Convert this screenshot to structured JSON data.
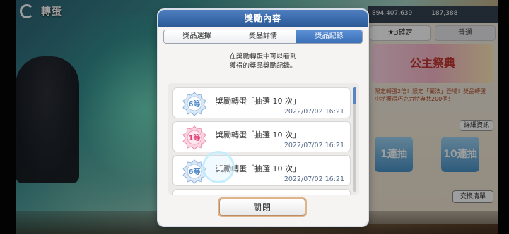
{
  "background": {
    "title": "轉蛋",
    "panel_tabs": [
      "★3確定",
      "普通"
    ],
    "banner_text": "公主祭典",
    "description": "限定轉蛋2倍！限定「蘭法」登場！獎品轉蛋中將獲得巧克力特典共200個！",
    "detail_button": "詳細資訊",
    "pull_buttons": [
      "1連抽",
      "10連抽"
    ],
    "exchange_button": "交換清單",
    "currency_1": "894,407,639",
    "currency_2": "187,388"
  },
  "modal": {
    "title": "獎勵內容",
    "tabs": [
      {
        "label": "獎品選擇",
        "active": false
      },
      {
        "label": "獎品詳情",
        "active": false
      },
      {
        "label": "獎品記錄",
        "active": true
      }
    ],
    "intro_line1": "在獎勵轉蛋中可以看到",
    "intro_line2": "獲得的獎品獎勵記錄。",
    "records": [
      {
        "medal": "6等",
        "medal_color": "#4a86c8",
        "name": "獎勵轉蛋「抽選 10 次」",
        "date": "2022/07/02 16:21"
      },
      {
        "medal": "1等",
        "medal_color": "#e0457a",
        "name": "獎勵轉蛋「抽選 10 次」",
        "date": "2022/07/02 16:21"
      },
      {
        "medal": "6等",
        "medal_color": "#4a86c8",
        "name": "獎勵轉蛋「抽選 10 次」",
        "date": "2022/07/02 16:21"
      }
    ],
    "close_label": "關閉"
  },
  "colors": {
    "header_blue": "#3868a8",
    "active_tab": "#4a7fc4",
    "date_text": "#5a6d8a",
    "close_border": "#e0b48a"
  }
}
